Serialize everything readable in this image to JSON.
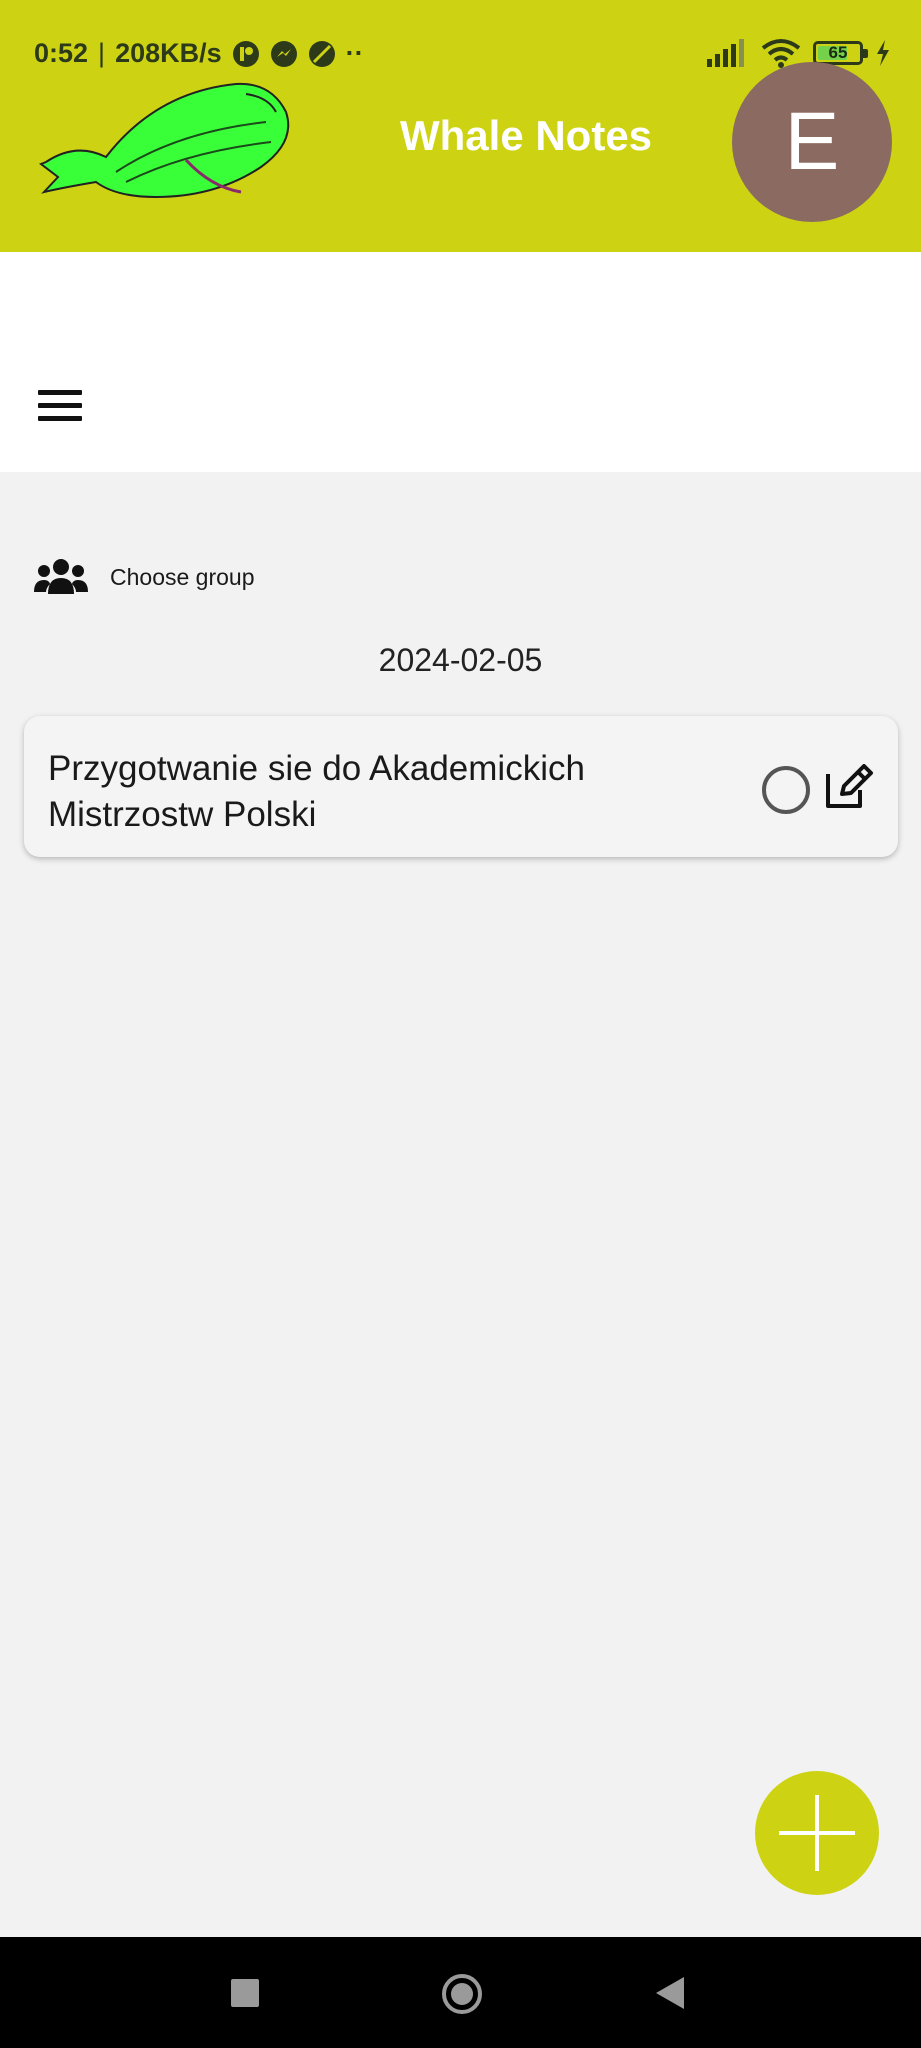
{
  "status_bar": {
    "time": "0:52",
    "separator": "|",
    "speed": "208KB/s",
    "notification_icons": [
      "app-icon",
      "messenger-icon",
      "leaf-icon",
      "more-dots-icon"
    ],
    "battery_level": "65",
    "battery_fill_percent": 65
  },
  "header": {
    "title": "Whale Notes",
    "avatar_letter": "E",
    "brand_color": "#cdd313",
    "avatar_color": "#8b6b61"
  },
  "filters": {
    "group_label": "Choose group"
  },
  "main": {
    "date": "2024-02-05",
    "notes": [
      {
        "text": "Przygotwanie sie do Akademickich Mistrzostw Polski"
      }
    ]
  }
}
